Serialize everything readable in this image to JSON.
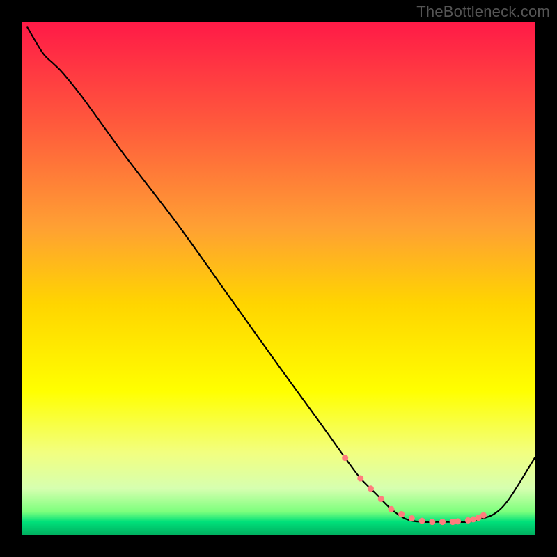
{
  "watermark": "TheBottleneck.com",
  "chart_data": {
    "type": "line",
    "title": "",
    "xlabel": "",
    "ylabel": "",
    "xlim": [
      0,
      100
    ],
    "ylim": [
      0,
      100
    ],
    "grid": false,
    "background_gradient": {
      "stops": [
        {
          "offset": 0.0,
          "color": "#ff1a47"
        },
        {
          "offset": 0.2,
          "color": "#ff5a3c"
        },
        {
          "offset": 0.4,
          "color": "#ffa033"
        },
        {
          "offset": 0.55,
          "color": "#ffd500"
        },
        {
          "offset": 0.72,
          "color": "#ffff00"
        },
        {
          "offset": 0.84,
          "color": "#f2ff80"
        },
        {
          "offset": 0.91,
          "color": "#d6ffb0"
        },
        {
          "offset": 0.955,
          "color": "#7dff7d"
        },
        {
          "offset": 0.975,
          "color": "#00e07a"
        },
        {
          "offset": 1.0,
          "color": "#00b060"
        }
      ]
    },
    "series": [
      {
        "name": "bottleneck-curve",
        "color": "#000000",
        "width": 2.2,
        "x": [
          1,
          4,
          6,
          8,
          12,
          20,
          30,
          40,
          50,
          58,
          63,
          66,
          69,
          72,
          75,
          78,
          81,
          84,
          87,
          89,
          92,
          95,
          100
        ],
        "y": [
          99,
          94,
          92,
          90,
          85,
          74,
          61,
          47,
          33,
          22,
          15,
          11,
          8,
          5,
          3,
          2.5,
          2.5,
          2.5,
          2.5,
          3,
          4,
          7,
          15
        ]
      }
    ],
    "markers": {
      "name": "highlight-points",
      "color": "#ff7d7d",
      "radius": 4.5,
      "x": [
        63,
        66,
        68,
        70,
        72,
        74,
        76,
        78,
        80,
        82,
        84,
        85,
        87,
        88,
        89,
        90
      ],
      "y": [
        15,
        11,
        9,
        7,
        5,
        4,
        3.2,
        2.7,
        2.5,
        2.5,
        2.5,
        2.6,
        2.8,
        3.0,
        3.3,
        3.8
      ]
    }
  }
}
